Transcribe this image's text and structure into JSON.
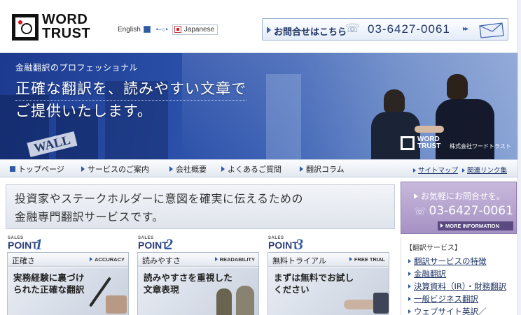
{
  "header": {
    "logo_line1": "WORD",
    "logo_line2": "TRUST",
    "lang_english": "English",
    "lang_japanese": "Japanese",
    "contact_label": "お問合せはこちら",
    "contact_phone": "03-6427-0061"
  },
  "hero": {
    "tagline": "金融翻訳のプロフェッショナル",
    "headline_line1": "正確な翻訳を、読みやすい文章で",
    "headline_line2": "ご提供いたします。",
    "wall_sign": "WALL",
    "brand_line1": "WORD",
    "brand_line2": "TRUST",
    "brand_company": "株式会社ワードトラスト"
  },
  "nav": {
    "items": [
      {
        "label": "トップページ"
      },
      {
        "label": "サービスのご案内"
      },
      {
        "label": "会社概要"
      },
      {
        "label": "よくあるご質問"
      },
      {
        "label": "翻訳コラム"
      }
    ],
    "sub_items": [
      {
        "label": "サイトマップ"
      },
      {
        "label": "関連リンク集"
      }
    ]
  },
  "main": {
    "lead_line1": "投資家やステークホルダーに意図を確実に伝えるための",
    "lead_line2": "金融専門翻訳サービスです。",
    "points": [
      {
        "sales": "SALES",
        "point": "POINT",
        "num": "1",
        "title": "正確さ",
        "eng": "ACCURACY",
        "body1": "実務経験に裏づけ",
        "body2": "られた正確な翻訳"
      },
      {
        "sales": "SALES",
        "point": "POINT",
        "num": "2",
        "title": "読みやすさ",
        "eng": "READABILITY",
        "body1": "読みやすさを重視した",
        "body2": "文章表現"
      },
      {
        "sales": "SALES",
        "point": "POINT",
        "num": "3",
        "title": "無料トライアル",
        "eng": "FREE TRIAL",
        "body1": "まずは無料でお試し",
        "body2": "ください"
      }
    ]
  },
  "side": {
    "cta_label": "お気軽にお問合せを。",
    "cta_phone": "03-6427-0061",
    "cta_more": "MORE INFORMATION",
    "services_head": "【翻訳サービス】",
    "services": [
      {
        "label": "翻訳サービスの特徴"
      },
      {
        "label": "金融翻訳"
      },
      {
        "label": "決算資料（IR）・財務翻訳"
      },
      {
        "label": "一般ビジネス翻訳"
      },
      {
        "label": "ウェブサイト英訳／"
      }
    ]
  },
  "colors": {
    "brand_navy": "#1f3566",
    "accent_blue": "#2d5aa3",
    "cta_purple": "#a591c3"
  }
}
